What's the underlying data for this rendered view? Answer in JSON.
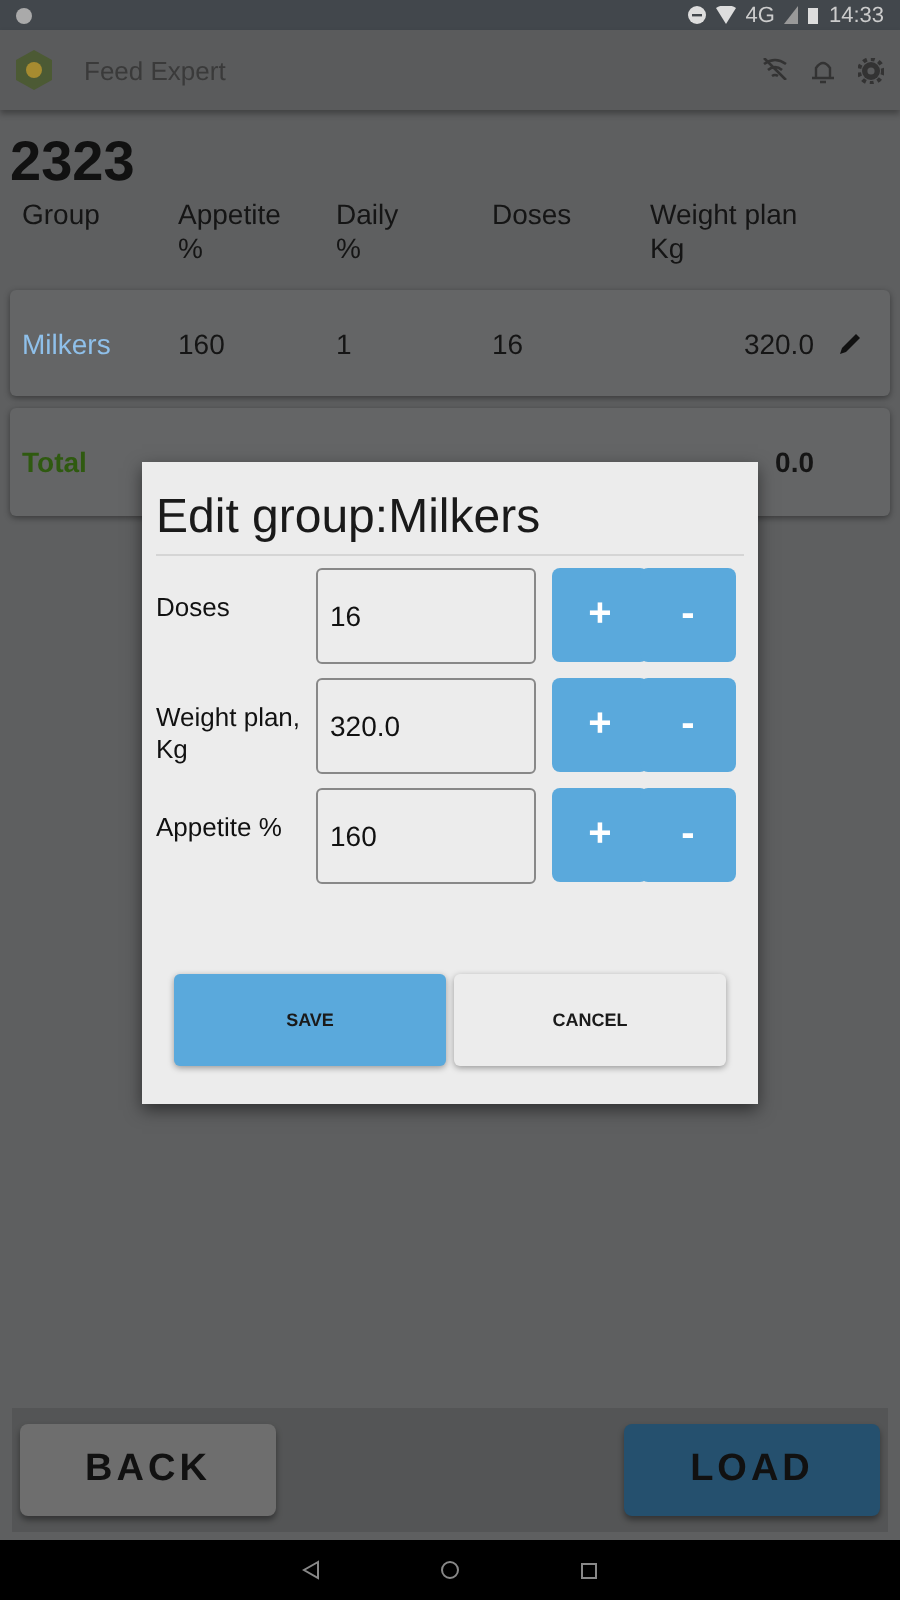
{
  "status_bar": {
    "network": "4G",
    "time": "14:33"
  },
  "app_bar": {
    "title": "Feed Expert"
  },
  "heading": "2323",
  "table": {
    "columns": [
      "Group",
      "Appetite\n%",
      "Daily\n%",
      "Doses",
      "Weight plan\nKg"
    ],
    "rows": [
      {
        "kind": "group",
        "cells": [
          "Milkers",
          "160",
          "1",
          "16",
          "320.0"
        ]
      },
      {
        "kind": "total",
        "cells": [
          "Total",
          "",
          "",
          "",
          "0.0"
        ]
      }
    ]
  },
  "dialog": {
    "title": "Edit group:Milkers",
    "fields": [
      {
        "label": "Doses",
        "value": "16",
        "plus": "+",
        "minus": "-"
      },
      {
        "label": "Weight plan,\nKg",
        "value": "320.0",
        "plus": "+",
        "minus": "-"
      },
      {
        "label": "Appetite %",
        "value": "160",
        "plus": "+",
        "minus": "-"
      }
    ],
    "buttons": [
      {
        "label": "SAVE",
        "kind": "primary"
      },
      {
        "label": "CANCEL",
        "kind": "secondary"
      }
    ]
  },
  "footer": {
    "buttons": [
      {
        "label": "BACK",
        "kind": "secondary"
      },
      {
        "label": "LOAD",
        "kind": "primary"
      }
    ]
  }
}
